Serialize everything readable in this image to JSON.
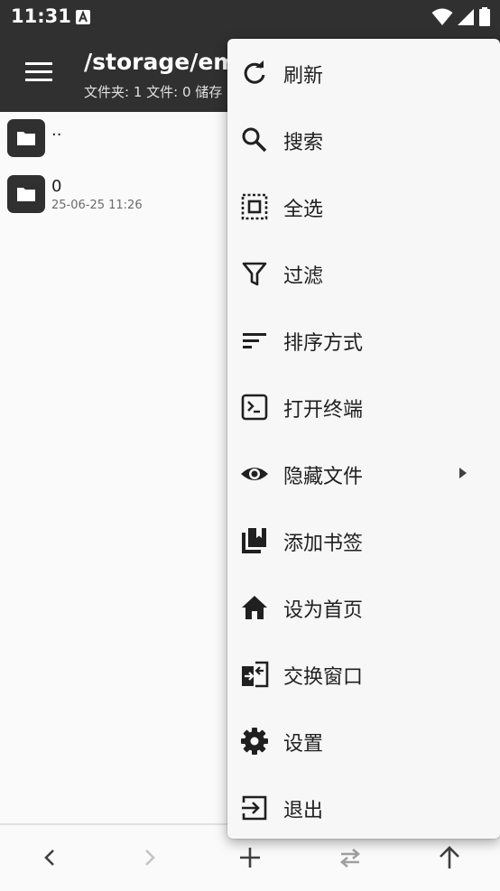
{
  "status_bar": {
    "time": "11:31"
  },
  "header": {
    "path": "/storage/emu",
    "info": "文件夹: 1  文件: 0  储存"
  },
  "files": [
    {
      "name": "..",
      "meta": ""
    },
    {
      "name": "0",
      "meta": "25-06-25 11:26"
    }
  ],
  "menu": {
    "items": [
      {
        "label": "刷新",
        "icon": "refresh-icon"
      },
      {
        "label": "搜索",
        "icon": "search-icon"
      },
      {
        "label": "全选",
        "icon": "select-all-icon"
      },
      {
        "label": "过滤",
        "icon": "filter-icon"
      },
      {
        "label": "排序方式",
        "icon": "sort-icon"
      },
      {
        "label": "打开终端",
        "icon": "terminal-icon"
      },
      {
        "label": "隐藏文件",
        "icon": "eye-icon",
        "submenu": true
      },
      {
        "label": "添加书签",
        "icon": "bookmark-icon"
      },
      {
        "label": "设为首页",
        "icon": "home-icon"
      },
      {
        "label": "交换窗口",
        "icon": "swap-window-icon"
      },
      {
        "label": "设置",
        "icon": "gear-icon"
      },
      {
        "label": "退出",
        "icon": "exit-icon"
      }
    ]
  },
  "bottom_bar": {
    "buttons": [
      "back-icon",
      "forward-icon",
      "add-icon",
      "swap-icon",
      "up-icon"
    ]
  },
  "colors": {
    "app_bar": "#303030",
    "menu_background": "#f7f7f7",
    "icon": "#202020"
  }
}
